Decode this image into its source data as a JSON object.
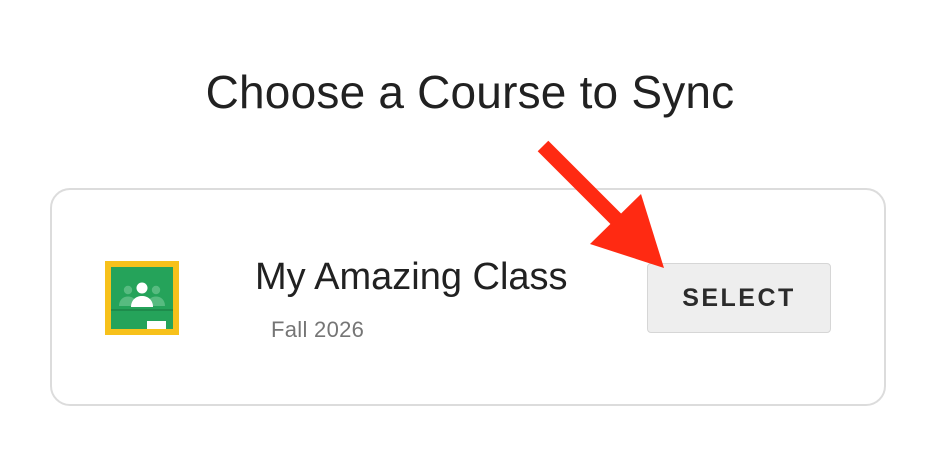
{
  "page": {
    "title": "Choose a Course to Sync"
  },
  "course": {
    "name": "My Amazing Class",
    "term": "Fall 2026",
    "select_label": "SELECT",
    "logo_icon": "google-classroom-icon"
  },
  "colors": {
    "annotation_arrow": "#ff2a12",
    "classroom_green": "#25a35a",
    "classroom_frame": "#f7c11b"
  }
}
